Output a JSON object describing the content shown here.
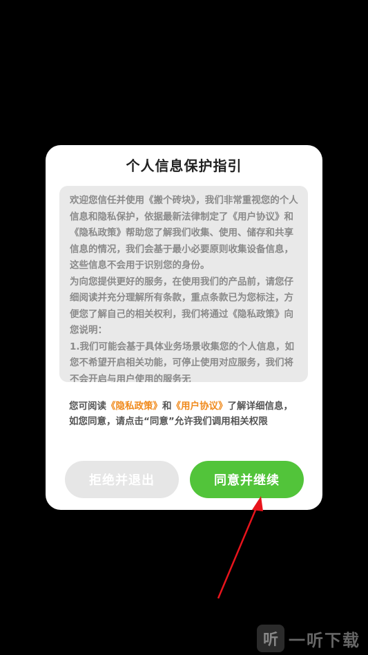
{
  "dialog": {
    "title": "个人信息保护指引",
    "paragraphs": [
      "欢迎您信任并使用《搬个砖块》，我们非常重视您的个人信息和隐私保护，依据最新法律制定了《用户协议》和《隐私政策》帮助您了解我们收集、使用、储存和共享信息的情况，我们会基于最小必要原则收集设备信息，这些信息不会用于识别您的身份。",
      "为向您提供更好的服务，在使用我们的产品前，请您仔细阅读并充分理解所有条款，重点条款已为您标注，方便您了解自己的相关权利，我们将通过《隐私政策》向您说明：",
      "1.我们可能会基于具体业务场景收集您的个人信息，如您不希望开启相关功能，可停止使用对应服务，我们将不会开启与用户使用的服务无"
    ],
    "notice": {
      "prefix": "您可阅读",
      "privacy_link": "《隐私政策》",
      "and": "和",
      "agreement_link": "《用户协议》",
      "suffix": "了解详细信息，如您同意，请点击“同意”允许我们调用相关权限"
    },
    "reject_label": "拒绝并退出",
    "agree_label": "同意并继续"
  },
  "watermark": {
    "icon_char": "听",
    "text": "一听下载"
  },
  "colors": {
    "agree": "#52c43a",
    "link": "#f08a1c",
    "arrow": "#e8141c"
  }
}
